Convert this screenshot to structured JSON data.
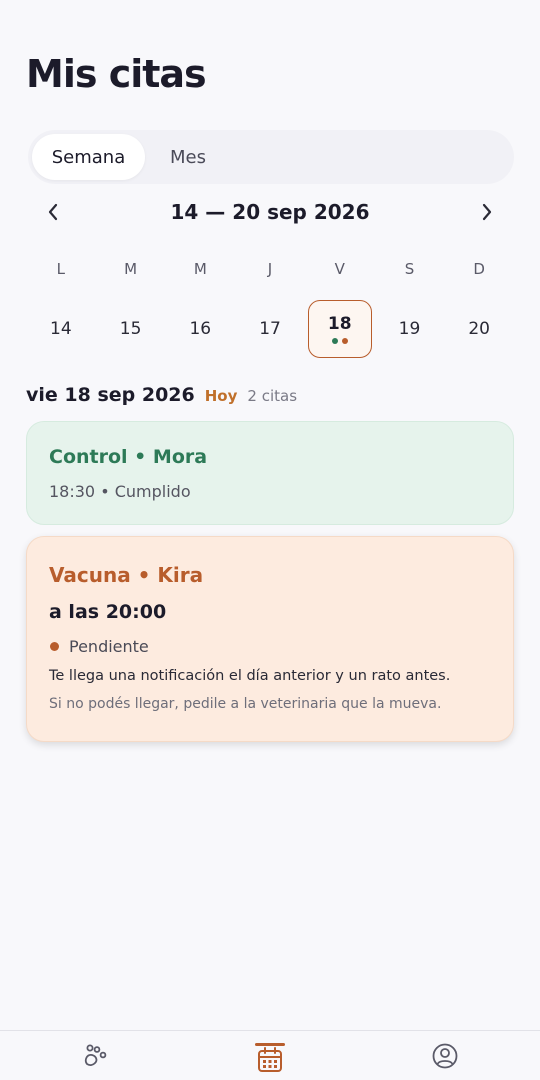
{
  "header": {
    "title": "Mis citas"
  },
  "view_toggle": {
    "week_label": "Semana",
    "month_label": "Mes",
    "selected": "Semana"
  },
  "week": {
    "label": "14 — 20 sep 2026",
    "days_of_week": [
      "L",
      "M",
      "M",
      "J",
      "V",
      "S",
      "D"
    ],
    "dates": [
      "14",
      "15",
      "16",
      "17",
      "18",
      "19",
      "20"
    ],
    "selected_date": "18",
    "event_dot_colors": [
      "#2d7a57",
      "#b85d2c"
    ]
  },
  "day": {
    "title": "vie 18 sep 2026",
    "today_badge": "Hoy",
    "count": "2 citas"
  },
  "appointments": [
    {
      "title": "Control • Mora",
      "subtitle": "18:30 • Cumplido",
      "status_color": "#2d7a57"
    },
    {
      "title": "Vacuna • Kira",
      "time": "a las 20:00",
      "status": "Pendiente",
      "status_color": "#b85d2c",
      "note": "Te llega una notificación el día anterior y un rato antes.",
      "hint": "Si no podés llegar, pedile a la veterinaria que la mueva."
    }
  ],
  "bottom_nav": {
    "items": [
      "paw-icon",
      "calendar-icon",
      "profile-icon"
    ],
    "active": "calendar-icon",
    "accent": "#b85d2c"
  }
}
